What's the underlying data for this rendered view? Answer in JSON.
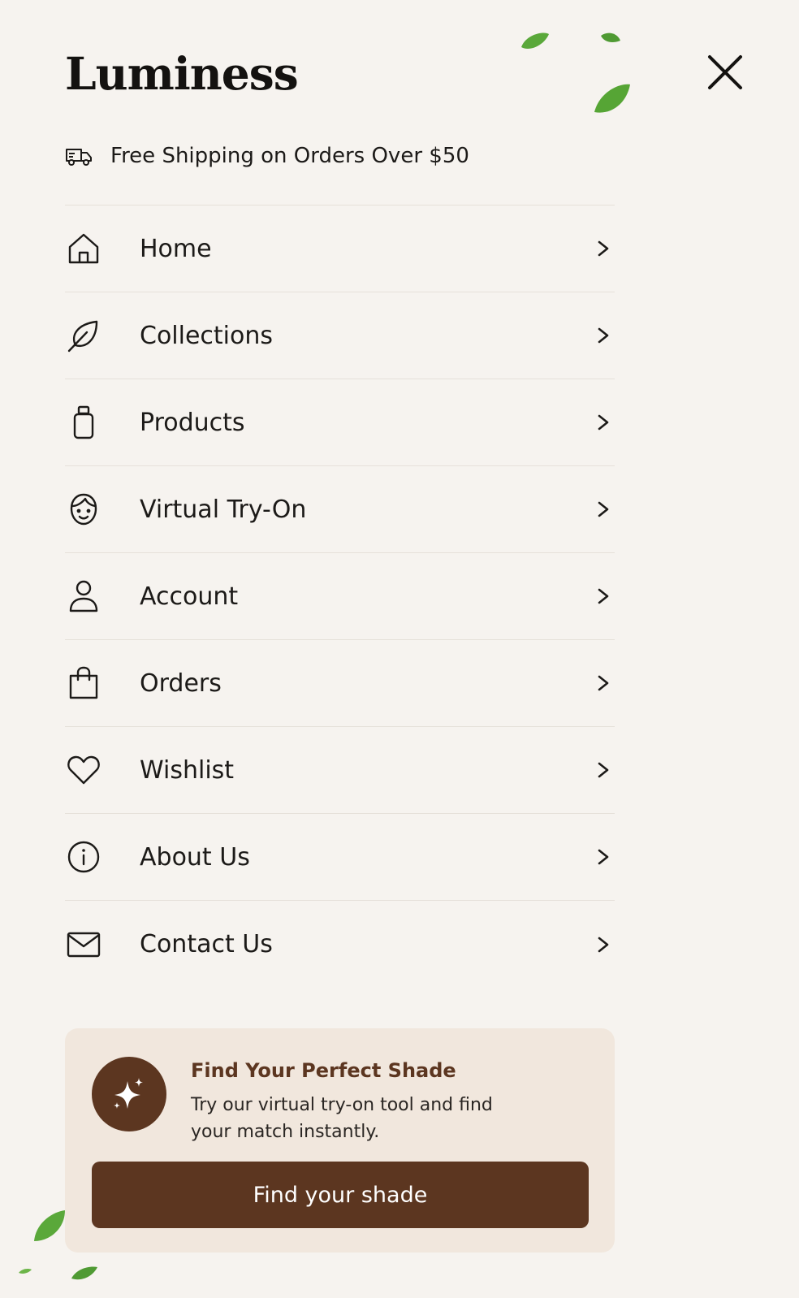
{
  "app": {
    "brand": "Luminess"
  },
  "header": {
    "close_icon": "close-icon"
  },
  "shipping": {
    "icon": "truck-icon",
    "text": "Free Shipping on Orders Over $50"
  },
  "menu": {
    "items": [
      {
        "label": "Home",
        "icon": "home-icon"
      },
      {
        "label": "Collections",
        "icon": "leaf-icon"
      },
      {
        "label": "Products",
        "icon": "bottle-icon"
      },
      {
        "label": "Virtual Try-On",
        "icon": "face-icon"
      },
      {
        "label": "Account",
        "icon": "user-icon"
      },
      {
        "label": "Orders",
        "icon": "shopping-bag-icon"
      },
      {
        "label": "Wishlist",
        "icon": "heart-icon"
      },
      {
        "label": "About Us",
        "icon": "info-icon"
      },
      {
        "label": "Contact Us",
        "icon": "mail-icon"
      }
    ]
  },
  "promo": {
    "icon": "sparkle-icon",
    "title": "Find Your Perfect Shade",
    "description": "Try our virtual try-on tool and find your match instantly.",
    "button_label": "Find your shade"
  },
  "colors": {
    "background": "#f6f3ef",
    "accent_brown": "#5c3620",
    "promo_background": "#f1e7dd",
    "leaf_green": "#5aa83a",
    "divider": "#e6e1da"
  }
}
